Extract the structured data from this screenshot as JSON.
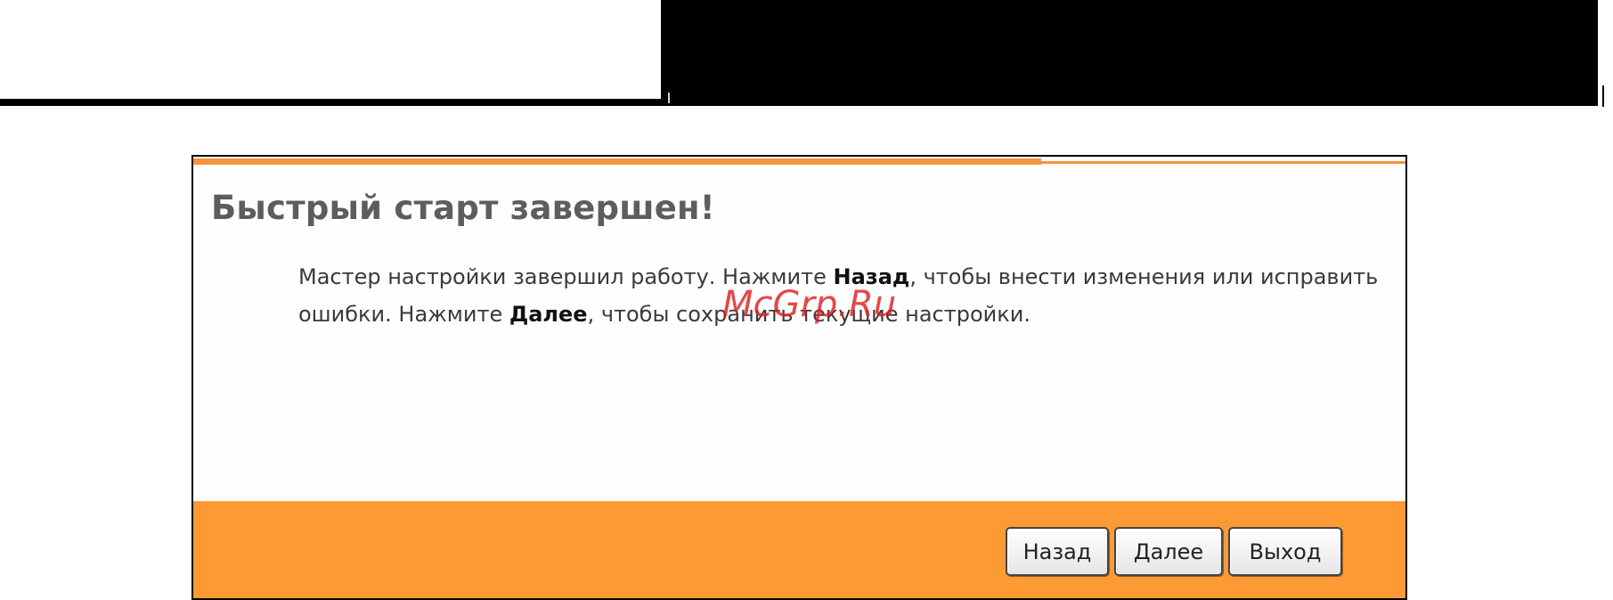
{
  "dialog": {
    "title": "Быстрый старт завершен!",
    "message": {
      "part1": "Мастер настройки завершил работу. Нажмите ",
      "back_keyword": "Назад",
      "part2": ", чтобы внести изменения или исправить ошибки. Нажмите ",
      "next_keyword": "Далее",
      "part3": ", чтобы сохранить текущие настройки."
    },
    "watermark": "McGrp.Ru"
  },
  "footer": {
    "back_label": "Назад",
    "next_label": "Далее",
    "exit_label": "Выход"
  },
  "colors": {
    "accent_orange": "#fd9a34",
    "title_gray": "#5d5d5d",
    "watermark_red": "#e02020"
  }
}
